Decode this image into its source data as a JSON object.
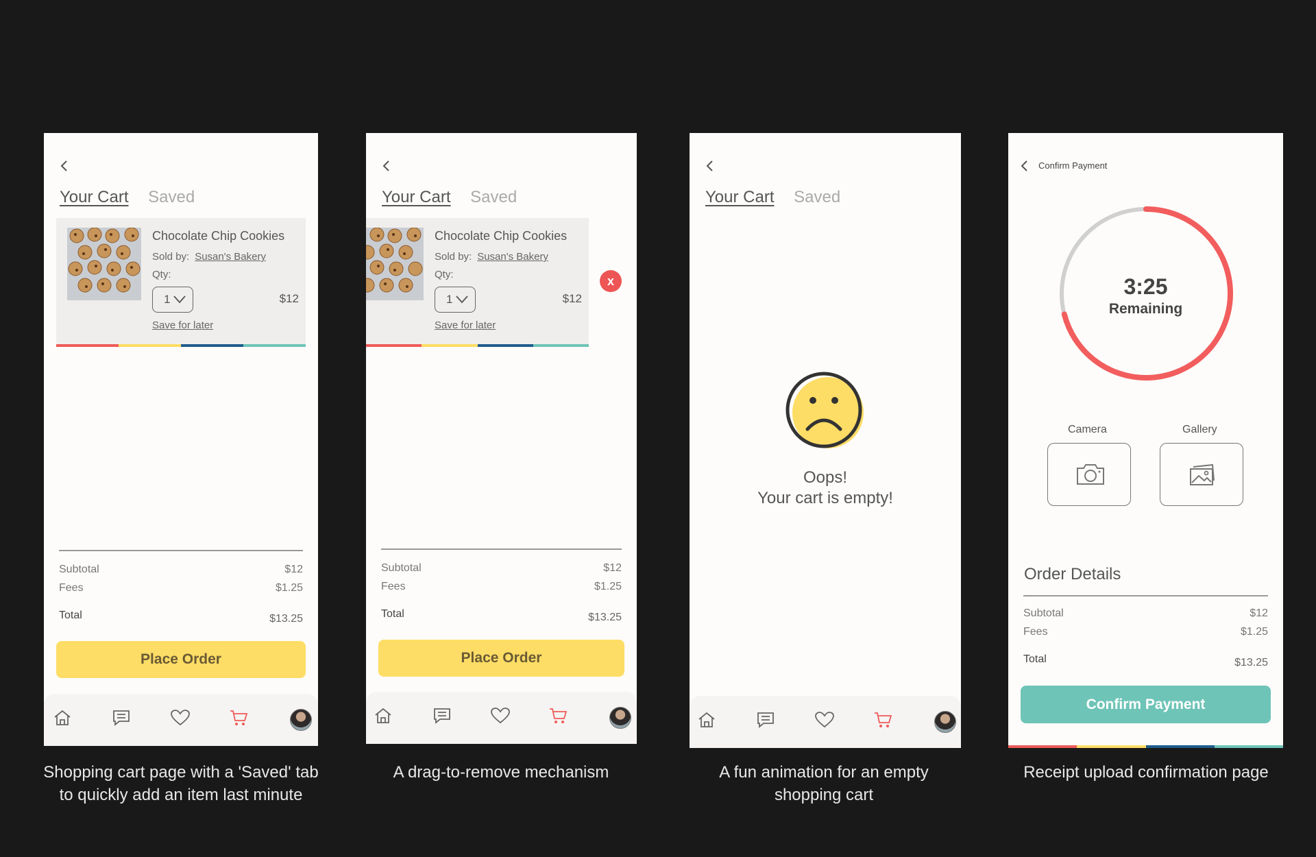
{
  "colors": {
    "red": "#ee5a5a",
    "yellow": "#fddd65",
    "blue": "#1f5c8c",
    "teal": "#6ec4b7"
  },
  "cart": {
    "tab_cart": "Your Cart",
    "tab_saved": "Saved",
    "item": {
      "name": "Chocolate Chip Cookies",
      "sold_by_label": "Sold by:",
      "seller": "Susan's Bakery",
      "qty_label": "Qty:",
      "qty": "1",
      "price": "$12",
      "save_for_later": "Save for later"
    },
    "summary": {
      "subtotal_label": "Subtotal",
      "subtotal": "$12",
      "fees_label": "Fees",
      "fees": "$1.25",
      "total_label": "Total",
      "total": "$13.25"
    },
    "place_order": "Place Order",
    "remove_icon_text": "x"
  },
  "empty": {
    "line1": "Oops!",
    "line2": "Your cart is empty!"
  },
  "confirm": {
    "title": "Confirm Payment",
    "timer": "3:25",
    "timer_label": "Remaining",
    "timer_progress": 0.71,
    "camera_label": "Camera",
    "gallery_label": "Gallery",
    "order_details": "Order Details",
    "button": "Confirm Payment"
  },
  "nav_icons": [
    "home-icon",
    "chat-icon",
    "heart-icon",
    "cart-icon",
    "avatar"
  ],
  "captions": {
    "c1a": "Shopping cart page with a 'Saved' tab",
    "c1b": "to quickly add an item last minute",
    "c2": "A drag-to-remove mechanism",
    "c3a": "A fun animation for an empty",
    "c3b": "shopping cart",
    "c4": "Receipt upload confirmation page"
  }
}
